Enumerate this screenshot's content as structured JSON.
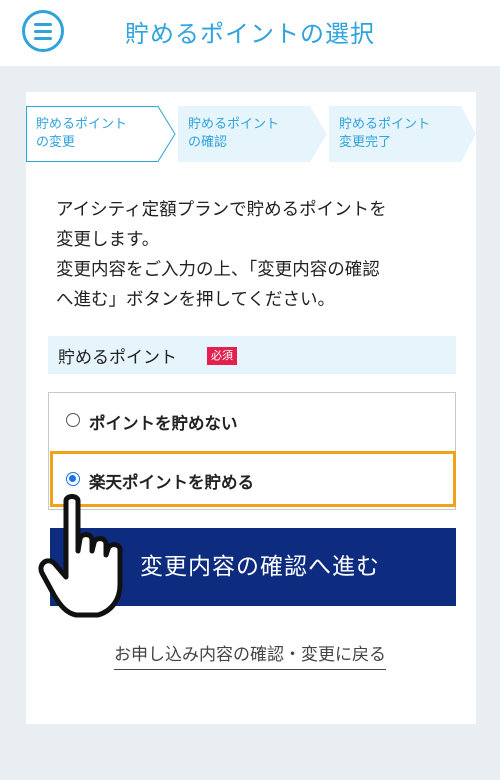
{
  "header": {
    "title": "貯めるポイントの選択",
    "menu_icon": "hamburger-menu-icon"
  },
  "steps": [
    {
      "line1": "貯めるポイント",
      "line2": "の変更",
      "state": "current"
    },
    {
      "line1": "貯めるポイント",
      "line2": "の確認",
      "state": "upcoming"
    },
    {
      "line1": "貯めるポイント",
      "line2": "変更完了",
      "state": "upcoming"
    }
  ],
  "intro": "アイシティ定額プランで貯めるポイントを\n変更します。\n変更内容をご入力の上、「変更内容の確認\nへ進む」ボタンを押してください。",
  "form": {
    "label": "貯めるポイント",
    "required": "必須",
    "options": [
      {
        "label": "ポイントを貯めない",
        "selected": false
      },
      {
        "label": "楽天ポイントを貯める",
        "selected": true
      }
    ]
  },
  "confirm_button": "変更内容の確認へ進む",
  "back_link": "お申し込み内容の確認・変更に戻る",
  "colors": {
    "accent": "#2ea3dc",
    "primary_button": "#0d2c7f",
    "highlight": "#f0a318",
    "required_badge": "#e3204e"
  }
}
